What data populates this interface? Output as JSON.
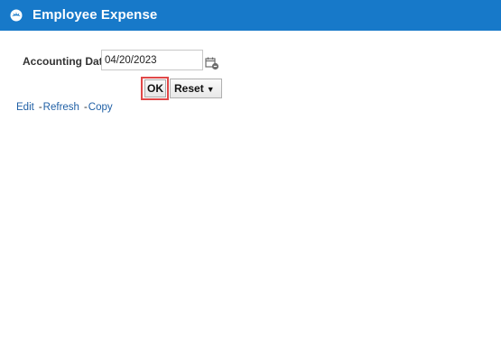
{
  "header": {
    "title": "Employee Expense",
    "icon": "app-logo-icon",
    "background": "#1779c9"
  },
  "form": {
    "accounting_date_label": "Accounting Date",
    "accounting_date_value": "04/20/2023",
    "calendar_icon": "calendar-icon",
    "ok_label": "OK",
    "reset_label": "Reset",
    "reset_arrow": "▼",
    "highlight_color": "#e04848"
  },
  "links": {
    "edit": "Edit",
    "refresh": "Refresh",
    "copy": "Copy",
    "separator": "-"
  }
}
